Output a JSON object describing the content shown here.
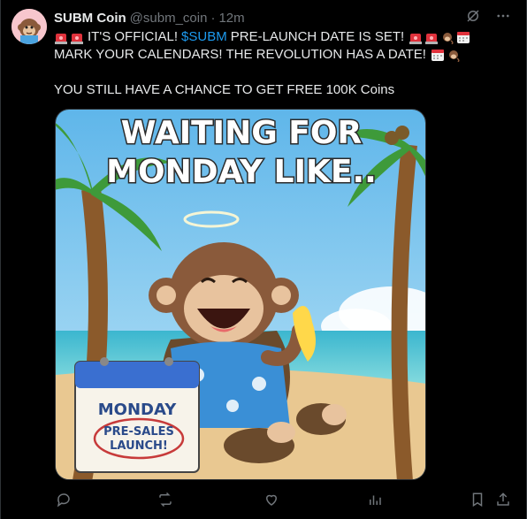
{
  "author": {
    "display_name": "SUBM Coin",
    "handle": "@subm_coin",
    "separator": "·",
    "time": "12m"
  },
  "top_icons": [
    "grok-icon",
    "more-icon"
  ],
  "tweet": {
    "line1_text_a": "IT'S OFFICIAL!",
    "line1_cashtag": "$SUBM",
    "line1_text_b": "PRE-LAUNCH DATE IS SET!",
    "line2_text": "MARK YOUR CALENDARS! THE REVOLUTION HAS A DATE!",
    "line3_text": "YOU STILL HAVE A CHANCE TO GET FREE 100K Coins"
  },
  "image": {
    "headline_line1": "WAITING FOR",
    "headline_line2": "MONDAY LIKE..",
    "calendar_day": "MONDAY",
    "calendar_note_line1": "PRE-SALES",
    "calendar_note_line2": "LAUNCH!"
  },
  "actions": [
    "reply-icon",
    "retweet-icon",
    "like-icon",
    "views-icon",
    "bookmark-icon",
    "share-icon"
  ],
  "colors": {
    "background": "#000000",
    "text": "#e7e9ea",
    "muted": "#71767b",
    "link": "#1d9bf0",
    "siren": "#e0323c"
  }
}
